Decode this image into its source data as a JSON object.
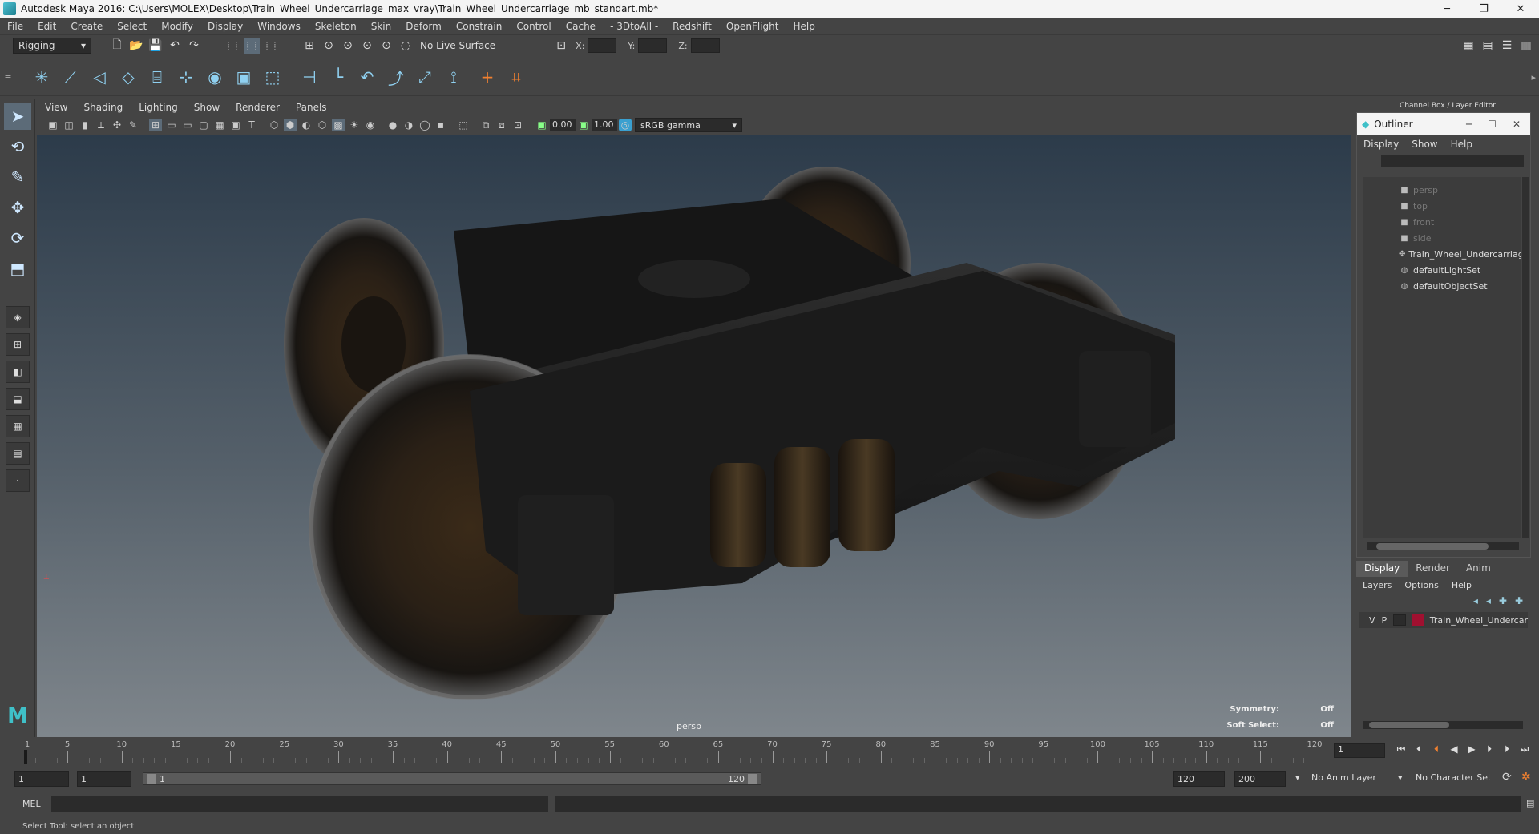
{
  "window": {
    "title": "Autodesk Maya 2016: C:\\Users\\MOLEX\\Desktop\\Train_Wheel_Undercarriage_max_vray\\Train_Wheel_Undercarriage_mb_standart.mb*",
    "minimize": "─",
    "restore": "❐",
    "close": "✕"
  },
  "menubar": [
    "File",
    "Edit",
    "Create",
    "Select",
    "Modify",
    "Display",
    "Windows",
    "Skeleton",
    "Skin",
    "Deform",
    "Constrain",
    "Control",
    "Cache",
    "- 3DtoAll -",
    "Redshift",
    "OpenFlight",
    "Help"
  ],
  "statusline": {
    "menuset": "Rigging",
    "live_surface": "No Live Surface",
    "x_label": "X:",
    "y_label": "Y:",
    "z_label": "Z:"
  },
  "panel": {
    "menus": [
      "View",
      "Shading",
      "Lighting",
      "Show",
      "Renderer",
      "Panels"
    ],
    "exposure": "0.00",
    "gamma": "1.00",
    "color_space": "sRGB gamma"
  },
  "viewport": {
    "camera": "persp",
    "symmetry_label": "Symmetry:",
    "symmetry_value": "Off",
    "soft_select_label": "Soft Select:",
    "soft_select_value": "Off"
  },
  "channel_box_header": "Channel Box / Layer Editor",
  "outliner": {
    "title": "Outliner",
    "menus": [
      "Display",
      "Show",
      "Help"
    ],
    "items": [
      {
        "label": "persp",
        "icon": "camera-icon",
        "dim": true
      },
      {
        "label": "top",
        "icon": "camera-icon",
        "dim": true
      },
      {
        "label": "front",
        "icon": "camera-icon",
        "dim": true
      },
      {
        "label": "side",
        "icon": "camera-icon",
        "dim": true
      },
      {
        "label": "Train_Wheel_Undercarriag",
        "icon": "transform-icon",
        "dim": false
      },
      {
        "label": "defaultLightSet",
        "icon": "set-icon",
        "dim": false
      },
      {
        "label": "defaultObjectSet",
        "icon": "set-icon",
        "dim": false
      }
    ]
  },
  "layer_editor": {
    "tabs": [
      "Display",
      "Render",
      "Anim"
    ],
    "menus": [
      "Layers",
      "Options",
      "Help"
    ],
    "layer": {
      "v": "V",
      "p": "P",
      "name": "Train_Wheel_Undercar",
      "color": "#a01030"
    }
  },
  "timeline": {
    "ticks": [
      1,
      5,
      10,
      15,
      20,
      25,
      30,
      35,
      40,
      45,
      50,
      55,
      60,
      65,
      70,
      75,
      80,
      85,
      90,
      95,
      100,
      105,
      110,
      115,
      120
    ],
    "current_frame": "1"
  },
  "range": {
    "start": "1",
    "playback_start": "1",
    "slider_start": "1",
    "slider_end": "120",
    "playback_end": "120",
    "end": "200",
    "anim_layer": "No Anim Layer",
    "character_set": "No Character Set"
  },
  "cmdline": {
    "label": "MEL"
  },
  "helpline": "Select Tool: select an object"
}
